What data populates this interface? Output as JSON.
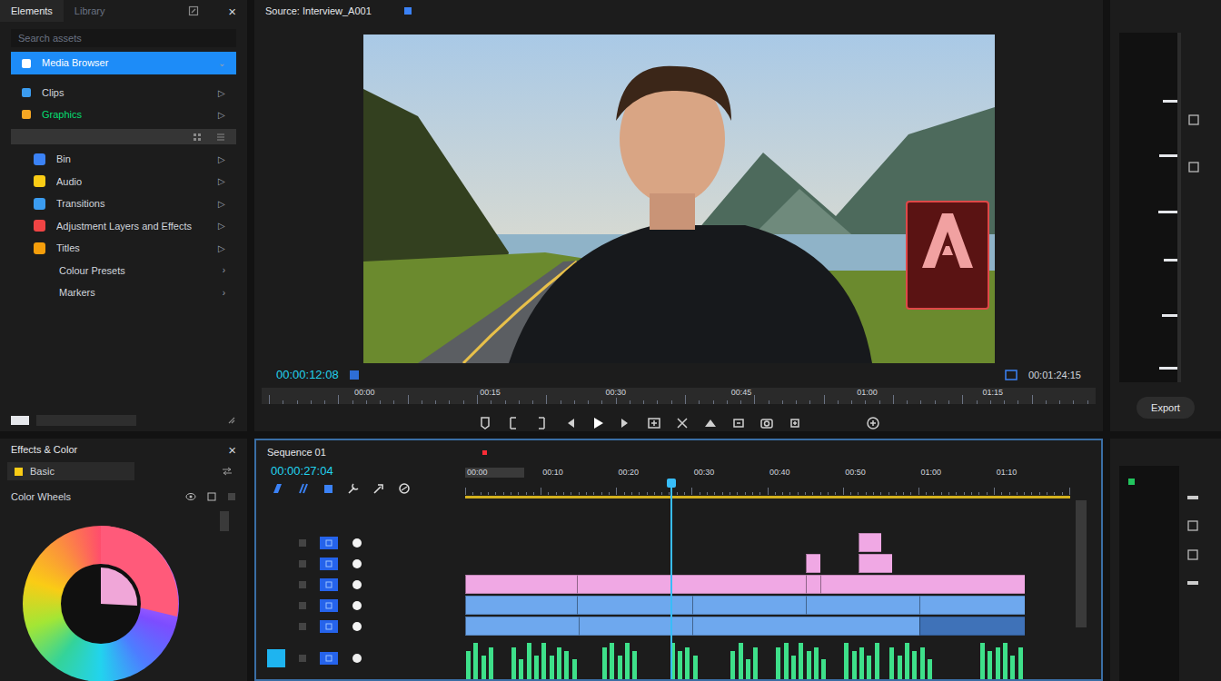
{
  "elements_panel": {
    "tabs": [
      {
        "label": "Elements",
        "selected": true
      },
      {
        "label": "Library",
        "selected": false
      }
    ],
    "close": "×",
    "search": {
      "placeholder": "Search assets"
    },
    "items": [
      {
        "label": "Media Browser",
        "chevron": "⌄",
        "selected": true,
        "active": false,
        "color": "#ffffff"
      },
      {
        "label": "Clips",
        "chevron": "▷",
        "selected": false,
        "active": false,
        "color": "#3b9cf0"
      },
      {
        "label": "Graphics",
        "chevron": "▷",
        "selected": false,
        "active": true,
        "color": "#f5a623"
      }
    ],
    "library": [
      {
        "label": "Bin",
        "chevron": "▷",
        "color": "#3b82f6"
      },
      {
        "label": "Audio",
        "chevron": "▷",
        "color": "#facc15"
      },
      {
        "label": "Transitions",
        "chevron": "▷",
        "color": "#3b9cf0"
      },
      {
        "label": "Adjustment Layers and Effects",
        "chevron": "▷",
        "color": "#ef4444"
      },
      {
        "label": "Titles",
        "chevron": "▷",
        "color": "#f59e0b"
      },
      {
        "label": "Colour Presets",
        "chevron": "›"
      },
      {
        "label": "Markers",
        "chevron": "›"
      }
    ]
  },
  "monitor": {
    "title": "Source: Interview_A001",
    "current_time": "00:00:12:08",
    "duration": "00:01:24:15",
    "ruler": [
      "00:00",
      "00:15",
      "00:30",
      "00:45",
      "01:00",
      "01:15"
    ]
  },
  "side_panel": {
    "button": "Export"
  },
  "effects_panel": {
    "title": "Effects & Color",
    "close": "×",
    "preset": "Basic",
    "section": "Color Wheels"
  },
  "timeline": {
    "title": "Sequence 01",
    "timecode": "00:00:27:04",
    "ruler": [
      "00:00",
      "00:10",
      "00:20",
      "00:30",
      "00:40",
      "00:50",
      "01:00",
      "01:10"
    ],
    "length": 80,
    "playhead": {
      "level": 0.34
    },
    "tracks": [
      {
        "kind": "video",
        "targeted": false,
        "clips": [
          {
            "start": 52,
            "duration": 3,
            "color": "#f0a8e4"
          }
        ]
      },
      {
        "kind": "video",
        "targeted": false,
        "clips": [
          {
            "start": 45,
            "duration": 2,
            "color": "#f0a8e4"
          },
          {
            "start": 52,
            "duration": 4.5,
            "color": "#f0a8e4"
          }
        ]
      },
      {
        "kind": "video",
        "targeted": false,
        "clips": [
          {
            "start": 0,
            "duration": 14.8,
            "color": "#f0a8e4"
          },
          {
            "start": 14.8,
            "duration": 30.2,
            "color": "#f0a8e4"
          },
          {
            "start": 45,
            "duration": 2,
            "color": "#f0a8e4"
          },
          {
            "start": 47,
            "duration": 27,
            "color": "#f0a8e4"
          }
        ]
      },
      {
        "kind": "video",
        "targeted": false,
        "clips": [
          {
            "start": 0,
            "duration": 14.8,
            "color": "#6ea8ee"
          },
          {
            "start": 14.8,
            "duration": 15.2,
            "color": "#6ea8ee"
          },
          {
            "start": 30,
            "duration": 15,
            "color": "#6ea8ee"
          },
          {
            "start": 45,
            "duration": 15,
            "color": "#6ea8ee"
          },
          {
            "start": 60,
            "duration": 14,
            "color": "#6ea8ee"
          }
        ]
      },
      {
        "kind": "video",
        "targeted": false,
        "clips": [
          {
            "start": 0,
            "duration": 15,
            "color": "#6ea8ee"
          },
          {
            "start": 15,
            "duration": 15,
            "color": "#6ea8ee"
          },
          {
            "start": 30,
            "duration": 30,
            "color": "#6ea8ee"
          },
          {
            "start": 60,
            "duration": 14,
            "color": "#3f72b8"
          }
        ]
      },
      {
        "kind": "audio",
        "targeted": true,
        "levels": [
          0.7,
          0.9,
          0.6,
          0.8,
          0,
          0,
          0.8,
          0.5,
          0.9,
          0.6,
          0.9,
          0.6,
          0.8,
          0.7,
          0.5,
          0,
          0,
          0,
          0.8,
          0.9,
          0.6,
          0.9,
          0.7,
          0,
          0,
          0,
          0,
          0.9,
          0.7,
          0.8,
          0.6,
          0,
          0,
          0,
          0,
          0.7,
          0.9,
          0.5,
          0.8,
          0,
          0,
          0.8,
          0.9,
          0.6,
          0.9,
          0.7,
          0.8,
          0.5,
          0,
          0,
          0.9,
          0.7,
          0.8,
          0.6,
          0.9,
          0,
          0.8,
          0.6,
          0.9,
          0.7,
          0.8,
          0.5,
          0,
          0,
          0,
          0,
          0,
          0,
          0.9,
          0.7,
          0.8,
          0.9,
          0.6,
          0.8,
          0,
          0,
          0,
          0,
          0,
          0
        ]
      }
    ]
  }
}
